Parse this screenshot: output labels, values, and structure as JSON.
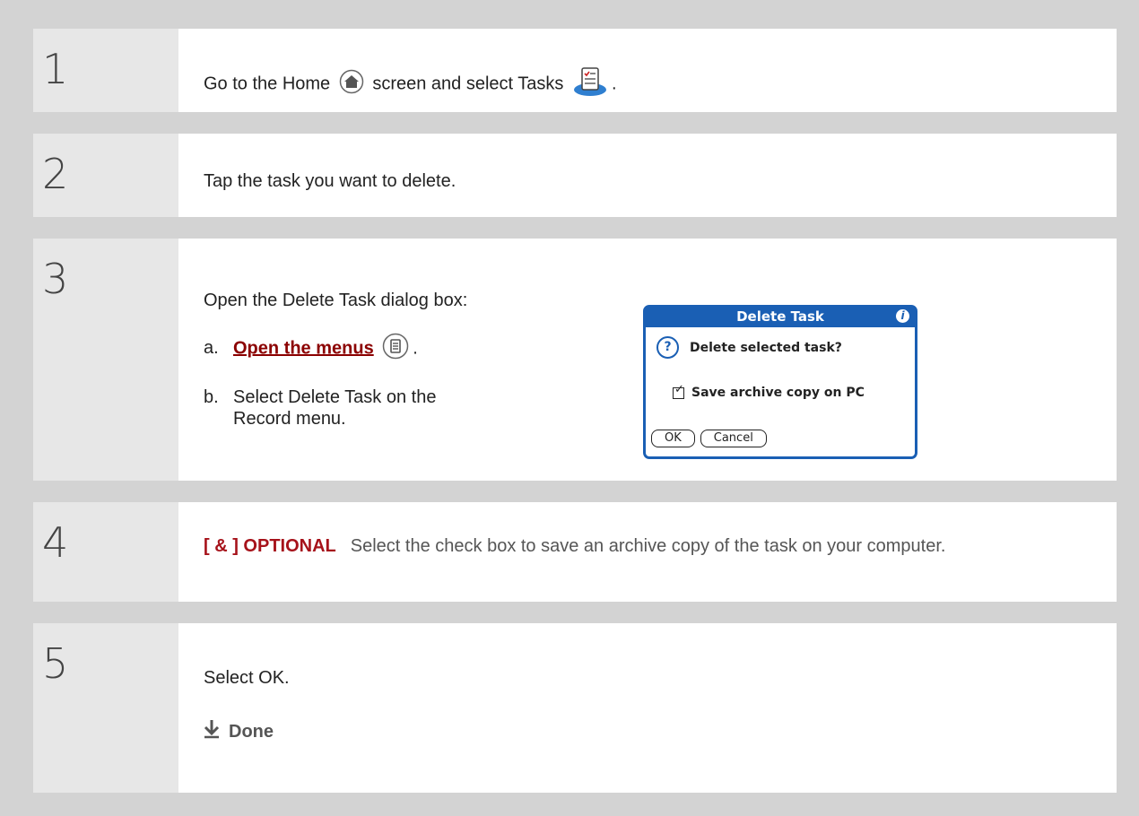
{
  "steps": [
    {
      "number": "1",
      "text_a": "Go to the Home",
      "text_b": "screen and select Tasks",
      "text_c": ".",
      "icons": [
        "home-icon",
        "tasks-icon"
      ]
    },
    {
      "number": "2",
      "text": "Tap the task you want to delete."
    },
    {
      "number": "3",
      "intro": "Open the Delete Task dialog box:",
      "a_label": "a.",
      "a_link": "Open the menus",
      "a_end": ".",
      "b_label": "b.",
      "b_text_1": "Select Delete Task on the",
      "b_text_2": "Record menu.",
      "dialog": {
        "title": "Delete Task",
        "question": "Delete selected task?",
        "checkbox_label": "Save archive copy on PC",
        "checkbox_checked": true,
        "ok": "OK",
        "cancel": "Cancel"
      }
    },
    {
      "number": "4",
      "optional_tag": "[ & ]  OPTIONAL",
      "text": "Select the check box to save an archive copy of the task on your computer."
    },
    {
      "number": "5",
      "text": "Select OK.",
      "done": "Done"
    }
  ],
  "colors": {
    "accent": "#a6121a",
    "dialog_blue": "#1a5fb4",
    "background": "#d3d3d3"
  }
}
